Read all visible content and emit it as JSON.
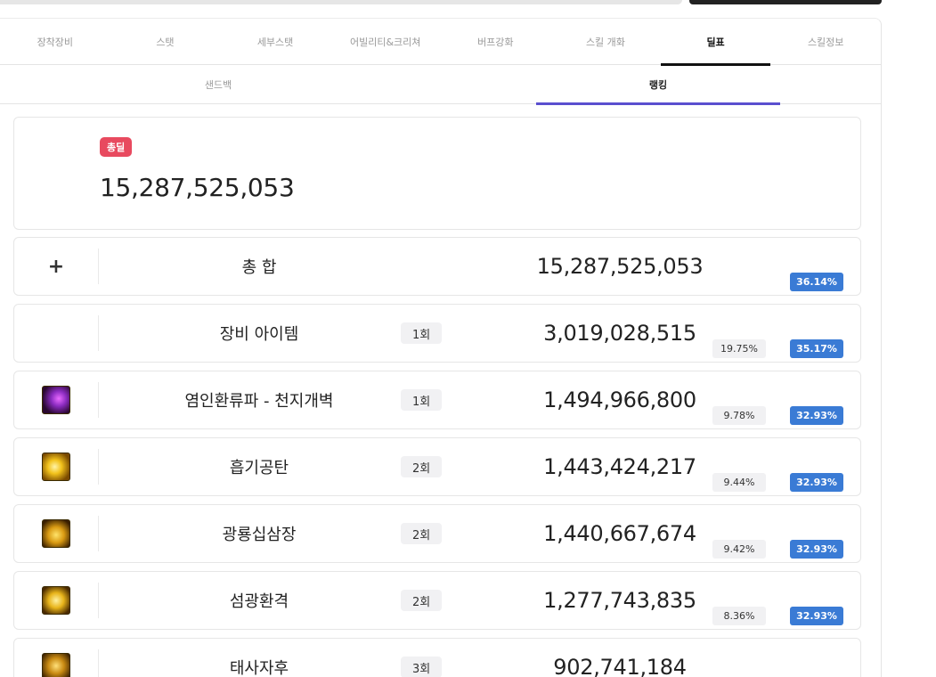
{
  "main_tabs": [
    "장착장비",
    "스탯",
    "세부스탯",
    "어빌리티&크리쳐",
    "버프강화",
    "스킬 개화",
    "딜표",
    "스킬정보"
  ],
  "sub_tabs": [
    "샌드백",
    "랭킹"
  ],
  "summary": {
    "badge": "총딜",
    "value": "15,287,525,053"
  },
  "rows": [
    {
      "icon": "plus-icon",
      "name": "총 합",
      "hits": "",
      "value": "15,287,525,053",
      "pct": "",
      "pct_blue": "36.14%"
    },
    {
      "icon": "",
      "name": "장비 아이템",
      "hits": "1회",
      "value": "3,019,028,515",
      "pct": "19.75%",
      "pct_blue": "35.17%"
    },
    {
      "icon": "skill-icon-crimson",
      "name": "염인환류파 - 천지개벽",
      "hits": "1회",
      "value": "1,494,966,800",
      "pct": "9.78%",
      "pct_blue": "32.93%"
    },
    {
      "icon": "skill-icon-golden-wave",
      "name": "흡기공탄",
      "hits": "2회",
      "value": "1,443,424,217",
      "pct": "9.44%",
      "pct_blue": "32.93%"
    },
    {
      "icon": "skill-icon-golden-dragon",
      "name": "광룡십삼장",
      "hits": "2회",
      "value": "1,440,667,674",
      "pct": "9.42%",
      "pct_blue": "32.93%"
    },
    {
      "icon": "skill-icon-golden-flash",
      "name": "섬광환격",
      "hits": "2회",
      "value": "1,277,743,835",
      "pct": "8.36%",
      "pct_blue": "32.93%"
    },
    {
      "icon": "skill-icon-golden-tiger",
      "name": "태사자후",
      "hits": "3회",
      "value": "902,741,184",
      "pct": "",
      "pct_blue": ""
    }
  ]
}
